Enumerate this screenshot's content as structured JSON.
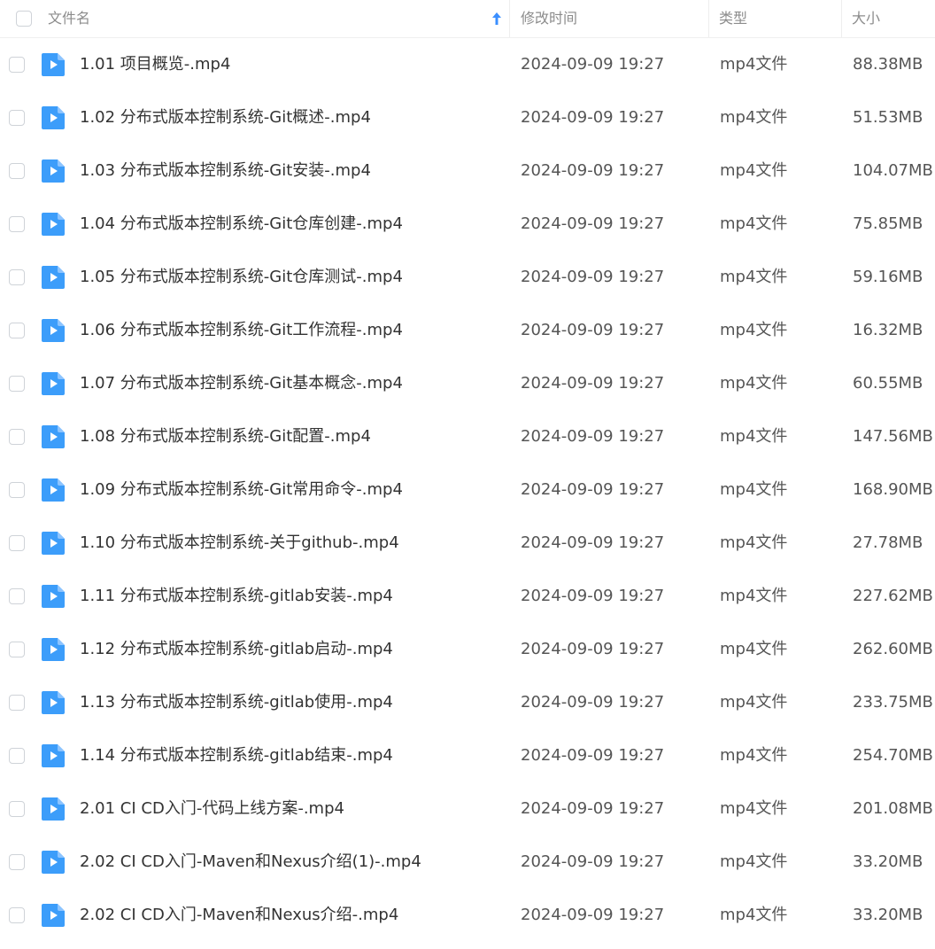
{
  "header": {
    "name": "文件名",
    "time": "修改时间",
    "type": "类型",
    "size": "大小"
  },
  "colors": {
    "accent": "#3b8fff",
    "icon": "#3c9dfa"
  },
  "rows": [
    {
      "name": "1.01 项目概览-.mp4",
      "time": "2024-09-09 19:27",
      "type": "mp4文件",
      "size": "88.38MB"
    },
    {
      "name": "1.02 分布式版本控制系统-Git概述-.mp4",
      "time": "2024-09-09 19:27",
      "type": "mp4文件",
      "size": "51.53MB"
    },
    {
      "name": "1.03 分布式版本控制系统-Git安装-.mp4",
      "time": "2024-09-09 19:27",
      "type": "mp4文件",
      "size": "104.07MB"
    },
    {
      "name": "1.04 分布式版本控制系统-Git仓库创建-.mp4",
      "time": "2024-09-09 19:27",
      "type": "mp4文件",
      "size": "75.85MB"
    },
    {
      "name": "1.05 分布式版本控制系统-Git仓库测试-.mp4",
      "time": "2024-09-09 19:27",
      "type": "mp4文件",
      "size": "59.16MB"
    },
    {
      "name": "1.06 分布式版本控制系统-Git工作流程-.mp4",
      "time": "2024-09-09 19:27",
      "type": "mp4文件",
      "size": "16.32MB"
    },
    {
      "name": "1.07 分布式版本控制系统-Git基本概念-.mp4",
      "time": "2024-09-09 19:27",
      "type": "mp4文件",
      "size": "60.55MB"
    },
    {
      "name": "1.08 分布式版本控制系统-Git配置-.mp4",
      "time": "2024-09-09 19:27",
      "type": "mp4文件",
      "size": "147.56MB"
    },
    {
      "name": "1.09 分布式版本控制系统-Git常用命令-.mp4",
      "time": "2024-09-09 19:27",
      "type": "mp4文件",
      "size": "168.90MB"
    },
    {
      "name": "1.10 分布式版本控制系统-关于github-.mp4",
      "time": "2024-09-09 19:27",
      "type": "mp4文件",
      "size": "27.78MB"
    },
    {
      "name": "1.11 分布式版本控制系统-gitlab安装-.mp4",
      "time": "2024-09-09 19:27",
      "type": "mp4文件",
      "size": "227.62MB"
    },
    {
      "name": "1.12 分布式版本控制系统-gitlab启动-.mp4",
      "time": "2024-09-09 19:27",
      "type": "mp4文件",
      "size": "262.60MB"
    },
    {
      "name": "1.13 分布式版本控制系统-gitlab使用-.mp4",
      "time": "2024-09-09 19:27",
      "type": "mp4文件",
      "size": "233.75MB"
    },
    {
      "name": "1.14 分布式版本控制系统-gitlab结束-.mp4",
      "time": "2024-09-09 19:27",
      "type": "mp4文件",
      "size": "254.70MB"
    },
    {
      "name": "2.01 CI CD入门-代码上线方案-.mp4",
      "time": "2024-09-09 19:27",
      "type": "mp4文件",
      "size": "201.08MB"
    },
    {
      "name": "2.02 CI CD入门-Maven和Nexus介绍(1)-.mp4",
      "time": "2024-09-09 19:27",
      "type": "mp4文件",
      "size": "33.20MB"
    },
    {
      "name": "2.02 CI CD入门-Maven和Nexus介绍-.mp4",
      "time": "2024-09-09 19:27",
      "type": "mp4文件",
      "size": "33.20MB"
    }
  ]
}
